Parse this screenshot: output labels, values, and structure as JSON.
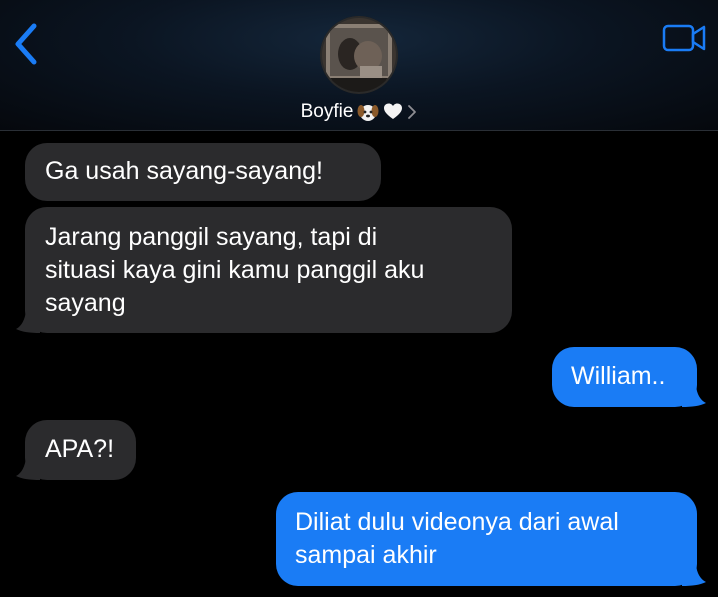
{
  "header": {
    "contact_name": "Boyfie",
    "back_icon": "chevron-left-icon",
    "video_icon": "video-camera-icon",
    "name_emojis": [
      "dog-face-emoji",
      "white-heart-emoji"
    ],
    "chevron": "chevron-right-icon"
  },
  "colors": {
    "background": "#000000",
    "incoming_bubble": "#2b2b2d",
    "outgoing_bubble": "#1a7cf5",
    "accent": "#1a7cf5",
    "text": "#ffffff"
  },
  "messages": [
    {
      "direction": "incoming",
      "lines": [
        "Ga usah sayang-sayang!"
      ]
    },
    {
      "direction": "incoming",
      "lines": [
        "Jarang panggil sayang, tapi di",
        "situasi kaya gini kamu panggil aku",
        "sayang"
      ]
    },
    {
      "direction": "outgoing",
      "lines": [
        "William.."
      ]
    },
    {
      "direction": "incoming",
      "lines": [
        "APA?!"
      ]
    },
    {
      "direction": "outgoing",
      "lines": [
        "Diliat dulu videonya dari awal",
        "sampai akhir"
      ]
    }
  ]
}
